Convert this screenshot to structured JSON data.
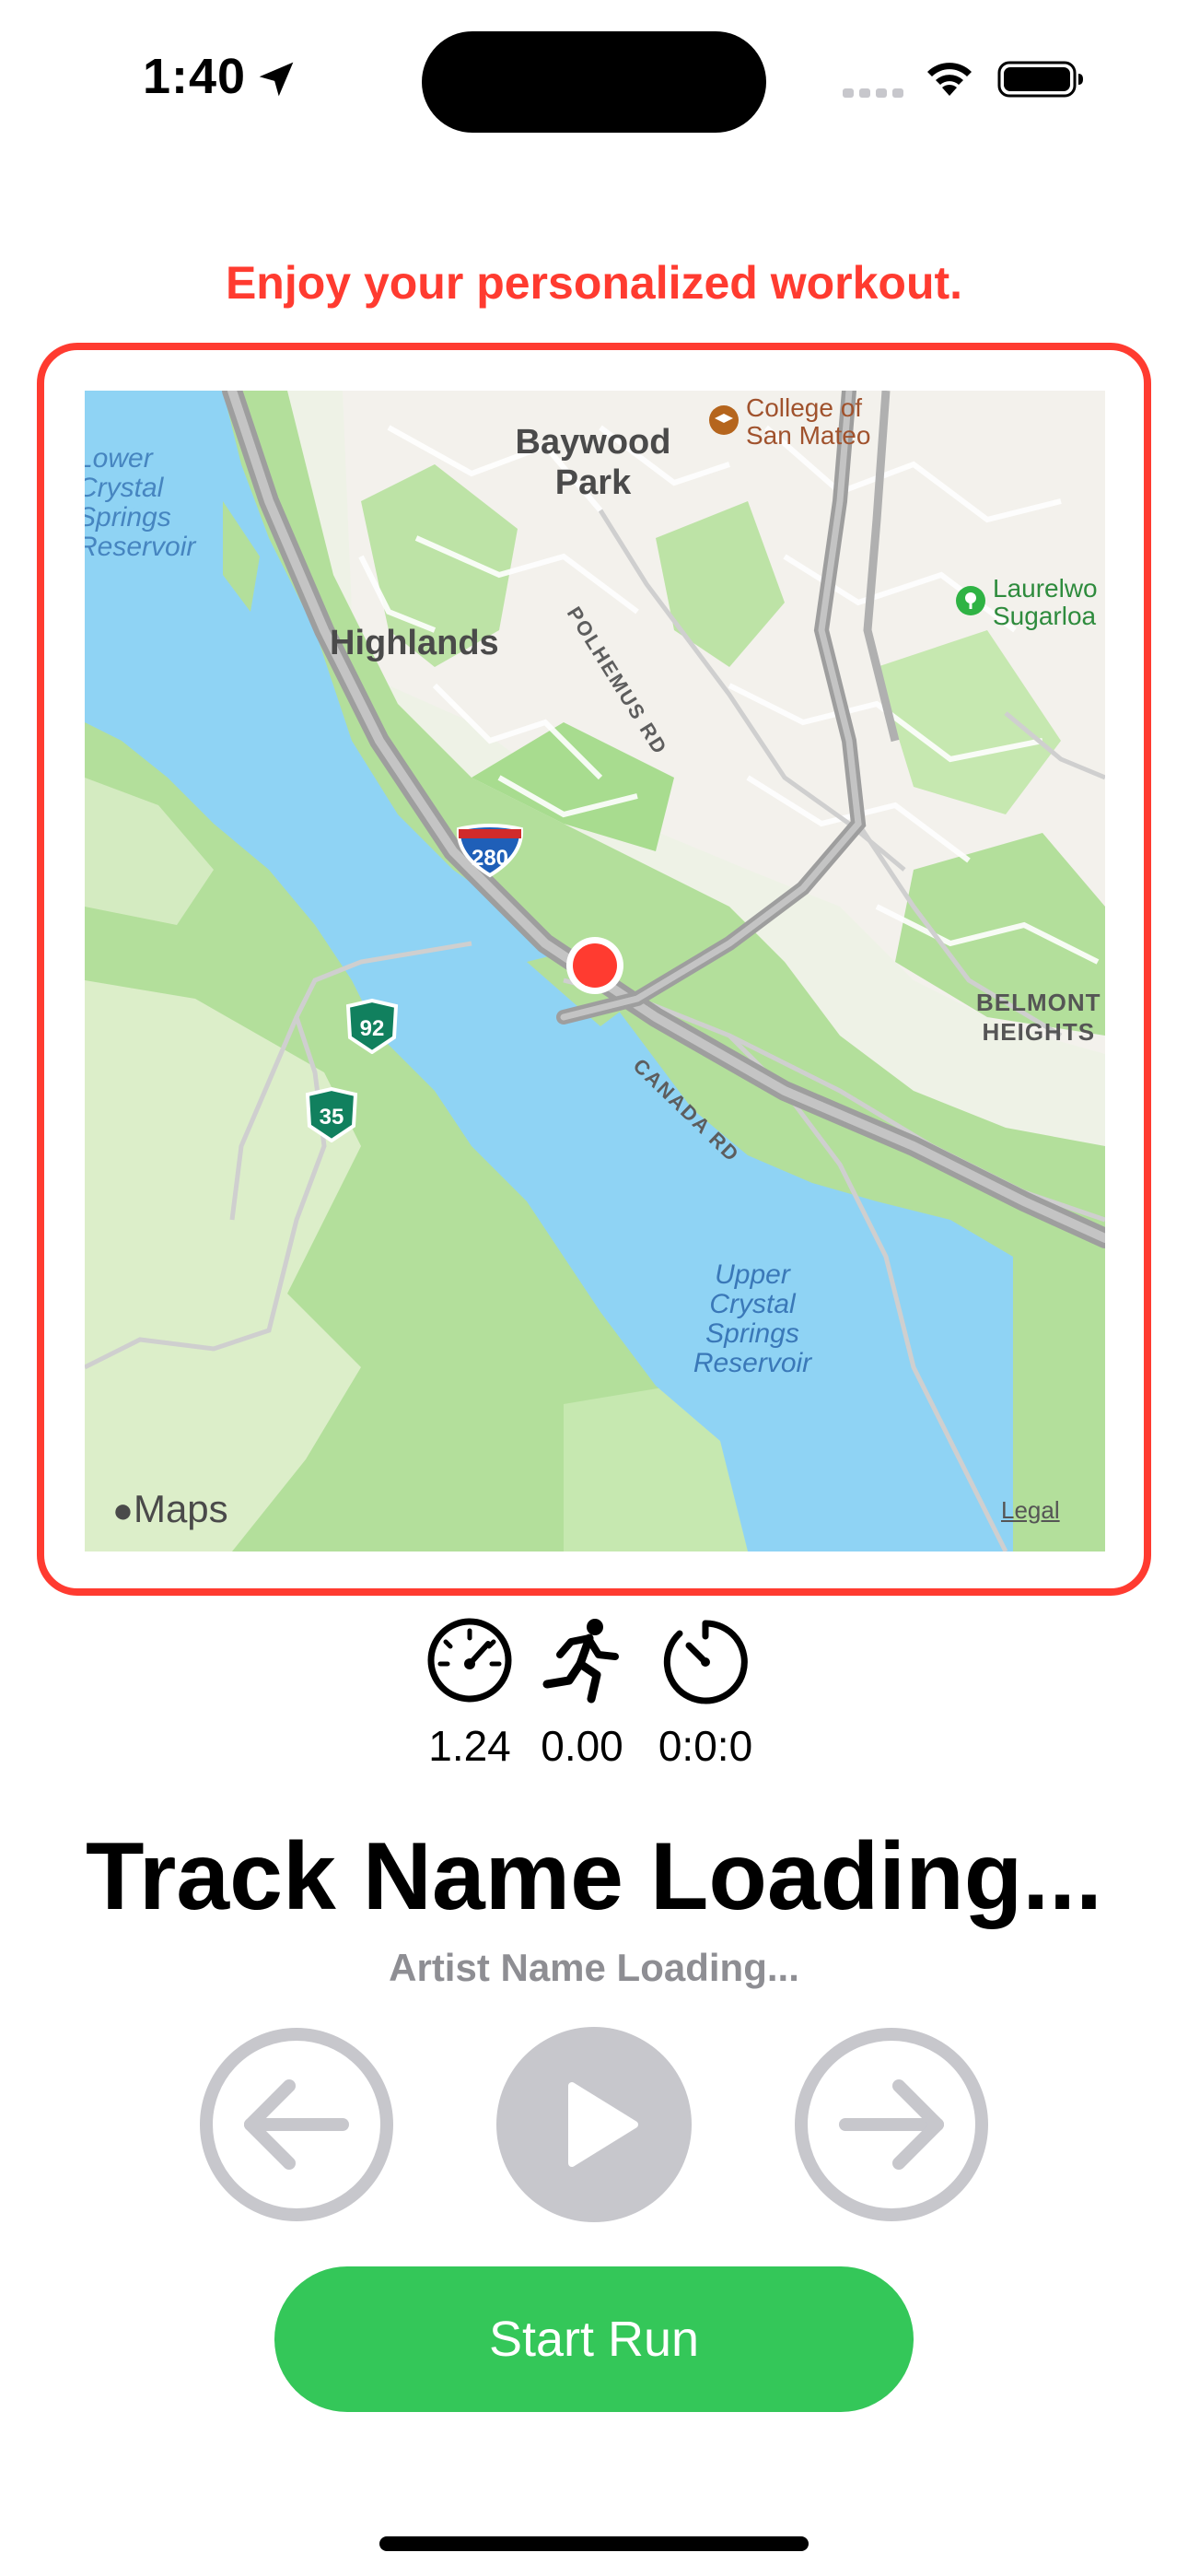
{
  "status_bar": {
    "time": "1:40",
    "icons": [
      "location-arrow-icon",
      "cellular-signal-icon",
      "wifi-icon",
      "battery-icon"
    ]
  },
  "subtitle": "Enjoy your personalized workout.",
  "map": {
    "places": {
      "baywood_park": "Baywood\nPark",
      "highlands": "Highlands",
      "belmont_heights": "BELMONT\nHEIGHTS"
    },
    "water": {
      "lower_reservoir": "Lower\nCrystal\nSprings\nReservoir",
      "upper_reservoir": "Upper\nCrystal\nSprings\nReservoir"
    },
    "pois": {
      "college": "College of\nSan Mateo",
      "laurelwood": "Laurelwo\nSugarloa"
    },
    "roads": {
      "polhemus": "POLHEMUS RD",
      "canada": "CANADA RD"
    },
    "shields": {
      "i280": "280",
      "ca92": "92",
      "ca35": "35"
    },
    "attribution": "Maps",
    "legal": "Legal",
    "colors": {
      "land": "#e9f1df",
      "park": "#a8dc8f",
      "water": "#8fd3f4",
      "highway": "#a0a0a0",
      "pin": "#ff3b30"
    }
  },
  "stats": {
    "speed": "1.24",
    "distance": "0.00",
    "time": "0:0:0"
  },
  "track": {
    "name": "Track Name Loading...",
    "artist": "Artist Name Loading..."
  },
  "controls": {
    "previous_icon": "arrow-left-circle-icon",
    "play_icon": "play-circle-icon",
    "next_icon": "arrow-right-circle-icon"
  },
  "start_button_label": "Start Run",
  "colors": {
    "accent_red": "#ff3b30",
    "accent_green": "#34c759",
    "control_gray": "#c7c7cc",
    "artist_gray": "#8e8e93"
  }
}
